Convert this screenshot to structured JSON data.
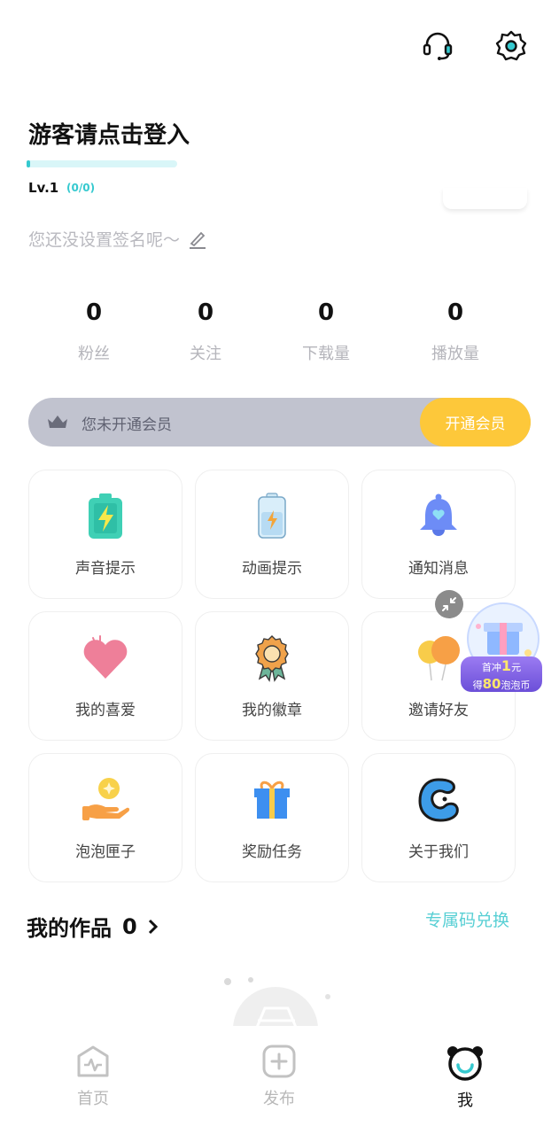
{
  "header": {
    "support_icon": "headset-icon",
    "settings_icon": "gear-icon"
  },
  "profile": {
    "username": "游客请点击登入",
    "level": "Lv.1",
    "level_progress": "(0/0)",
    "level_fraction": 0.0,
    "signature": "您还没设置签名呢～"
  },
  "stats": [
    {
      "value": "0",
      "label": "粉丝"
    },
    {
      "value": "0",
      "label": "关注"
    },
    {
      "value": "0",
      "label": "下载量"
    },
    {
      "value": "0",
      "label": "播放量"
    }
  ],
  "vip": {
    "status": "您未开通会员",
    "button": "开通会员"
  },
  "grid": [
    {
      "label": "声音提示",
      "icon": "battery-icon"
    },
    {
      "label": "动画提示",
      "icon": "charging-phone-icon"
    },
    {
      "label": "通知消息",
      "icon": "bell-icon"
    },
    {
      "label": "我的喜爱",
      "icon": "heart-icon"
    },
    {
      "label": "我的徽章",
      "icon": "badge-icon"
    },
    {
      "label": "邀请好友",
      "icon": "balloons-icon"
    },
    {
      "label": "泡泡匣子",
      "icon": "coin-hand-icon"
    },
    {
      "label": "奖励任务",
      "icon": "gift-icon"
    },
    {
      "label": "关于我们",
      "icon": "app-logo-icon"
    }
  ],
  "works": {
    "title": "我的作品",
    "count": "0",
    "redeem": "专属码兑换"
  },
  "float_ad": {
    "line1": "首冲",
    "amount": "1",
    "unit": "元",
    "line2_pre": "得",
    "coins": "80",
    "line2_post": "泡泡币"
  },
  "tabs": [
    {
      "label": "首页",
      "icon": "home-pulse-icon",
      "active": false
    },
    {
      "label": "发布",
      "icon": "plus-square-icon",
      "active": false
    },
    {
      "label": "我",
      "icon": "bear-face-icon",
      "active": true
    }
  ],
  "colors": {
    "accent": "#35c9cf",
    "vip_button": "#fdc83a",
    "vip_bar": "#c1c3cf",
    "muted": "#b5b5bb"
  }
}
